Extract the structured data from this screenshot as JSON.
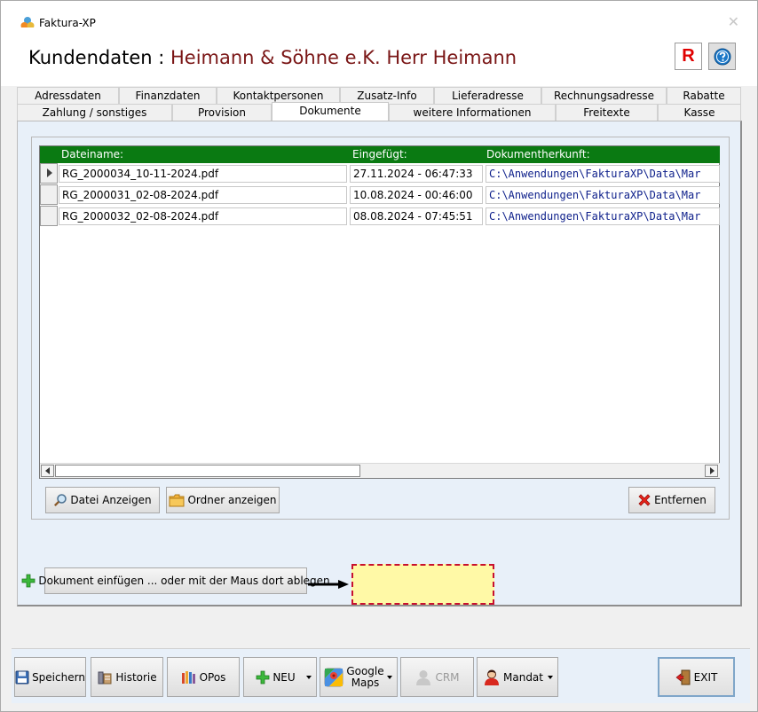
{
  "app": {
    "title": "Faktura-XP",
    "close_glyph": "✕"
  },
  "header": {
    "label": "Kundendaten : ",
    "customer": "Heimann & Söhne e.K. Herr Heimann",
    "r_button": "R"
  },
  "tabs": {
    "row1": [
      "Adressdaten",
      "Finanzdaten",
      "Kontaktpersonen",
      "Zusatz-Info",
      "Lieferadresse",
      "Rechnungsadresse",
      "Rabatte"
    ],
    "row2": [
      "Zahlung / sonstiges",
      "Provision",
      "Dokumente",
      "weitere Informationen",
      "Freitexte",
      "Kasse"
    ],
    "active": "Dokumente"
  },
  "grid": {
    "columns": [
      "Dateiname:",
      "Eingefügt:",
      "Dokumentherkunft:"
    ],
    "rows": [
      {
        "name": "RG_2000034_10-11-2024.pdf",
        "date": "27.11.2024 - 06:47:33",
        "source": "C:\\Anwendungen\\FakturaXP\\Data\\Mar"
      },
      {
        "name": "RG_2000031_02-08-2024.pdf",
        "date": "10.08.2024 - 00:46:00",
        "source": "C:\\Anwendungen\\FakturaXP\\Data\\Mar"
      },
      {
        "name": "RG_2000032_02-08-2024.pdf",
        "date": "08.08.2024 - 07:45:51",
        "source": "C:\\Anwendungen\\FakturaXP\\Data\\Mar"
      }
    ]
  },
  "buttons": {
    "show_file": "Datei Anzeigen",
    "show_folder": "Ordner anzeigen",
    "remove": "Entfernen",
    "insert": "Dokument einfügen ... oder mit der Maus dort ablegen"
  },
  "toolbar": {
    "save": "Speichern",
    "history": "Historie",
    "opos": "OPos",
    "new": "NEU",
    "maps_line1": "Google",
    "maps_line2": "Maps",
    "crm": "CRM",
    "mandate": "Mandat",
    "exit": "EXIT"
  },
  "colors": {
    "grid_header": "#0a7a12",
    "customer_name": "#7a1616",
    "dropzone_fill": "#fff9a6",
    "dropzone_border": "#c8102e",
    "path_text": "#0c1e8a"
  },
  "icons": [
    "app-logo-icon",
    "help-icon",
    "magnifier-icon",
    "folder-icon",
    "red-x-icon",
    "green-plus-icon",
    "floppy-icon",
    "history-icon",
    "ledger-icon",
    "google-maps-icon",
    "crm-person-icon",
    "mandate-person-icon",
    "exit-door-icon"
  ]
}
